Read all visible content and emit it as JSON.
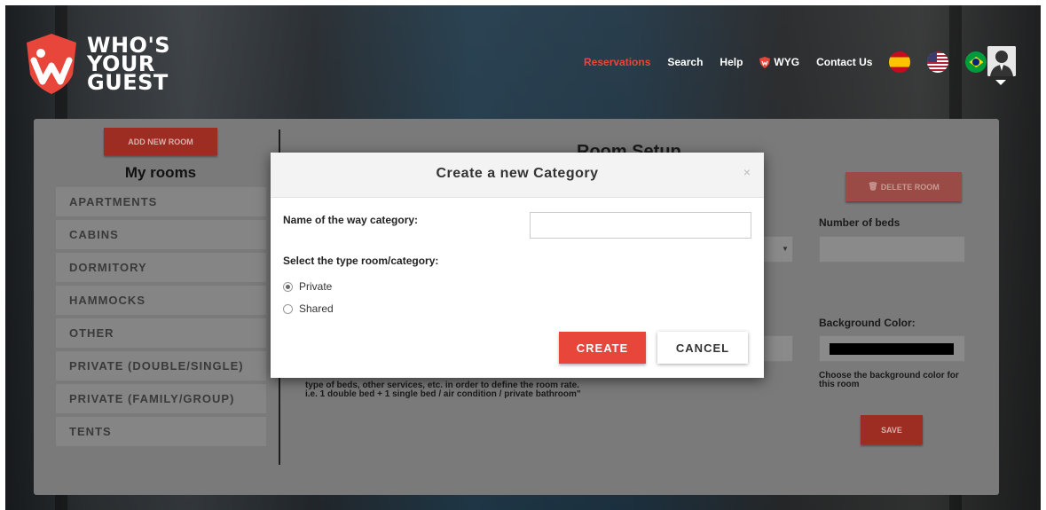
{
  "brand": {
    "logo_text_line1": "WHO'S",
    "logo_text_line2": "YOUR",
    "logo_text_line3": "GUEST",
    "accent_color": "#e8463a"
  },
  "nav": {
    "items": [
      {
        "label": "Reservations",
        "active": true
      },
      {
        "label": "Search",
        "active": false
      },
      {
        "label": "Help",
        "active": false
      },
      {
        "label": "WYG",
        "active": false,
        "icon": "shield-icon"
      },
      {
        "label": "Contact Us",
        "active": false
      }
    ],
    "flags": [
      "flag-spain-icon",
      "flag-usa-icon",
      "flag-brazil-icon"
    ],
    "avatar_icon": "user-avatar-icon"
  },
  "sidebar": {
    "add_room_label": "ADD NEW ROOM",
    "title": "My rooms",
    "rooms": [
      "APARTMENTS",
      "CABINS",
      "DORMITORY",
      "HAMMOCKS",
      "OTHER",
      "PRIVATE (DOUBLE/SINGLE)",
      "PRIVATE (FAMILY/GROUP)",
      "TENTS"
    ]
  },
  "room_setup": {
    "title": "Room Setup",
    "delete_label": "DELETE ROOM",
    "number_of_beds_label": "Number of beds",
    "background_color_label": "Background Color:",
    "background_color_value": "#000000",
    "background_help": "Choose the background color for this room",
    "description_help_line1": "type of beds, other services, etc. in order to define the room rate.",
    "description_help_line2": "i.e. 1 double bed + 1 single bed / air condition / private bathroom\"",
    "save_label": "SAVE"
  },
  "modal": {
    "title": "Create a new Category",
    "close_icon": "×",
    "name_label": "Name of the way category:",
    "name_value": "",
    "type_label": "Select the type room/category:",
    "options": [
      {
        "label": "Private",
        "checked": true
      },
      {
        "label": "Shared",
        "checked": false
      }
    ],
    "create_label": "CREATE",
    "cancel_label": "CANCEL"
  }
}
